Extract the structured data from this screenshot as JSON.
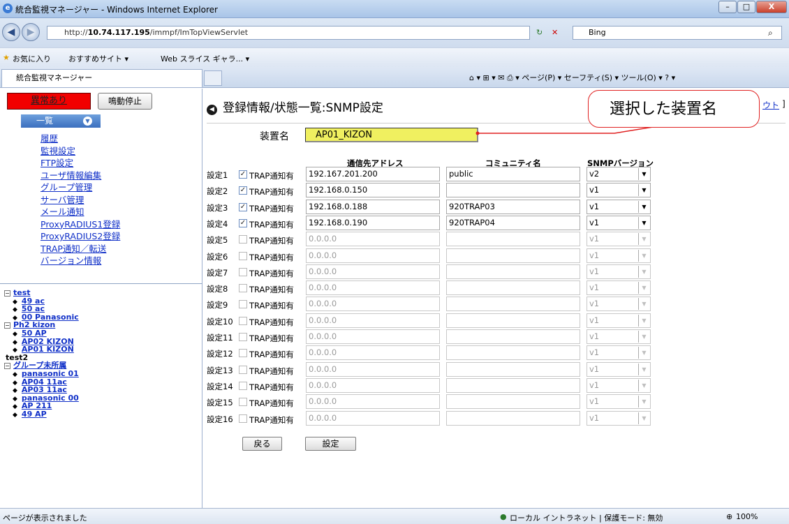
{
  "window": {
    "title": "統合監視マネージャー - Windows Internet Explorer",
    "min": "–",
    "max": "□",
    "close": "X"
  },
  "address": {
    "url_prefix": "http://",
    "url_host": "10.74.117.195",
    "url_path": "/immpf/ImTopViewServlet",
    "search_text": "Bing"
  },
  "favorites": {
    "fav": "お気に入り",
    "recommended": "おすすめサイト ▾",
    "webslice": "Web スライス ギャラ... ▾"
  },
  "tab": {
    "title": "統合監視マネージャー"
  },
  "commands": {
    "text": "⌂ ▾  ⊞ ▾  ✉  ⎙ ▾  ページ(P) ▾  セーフティ(S) ▾  ツール(O) ▾  ? ▾"
  },
  "sidebar": {
    "alarm": "異常あり",
    "stop": "鳴動停止",
    "list": "一覧",
    "menu": [
      "履歴",
      "監視設定",
      "FTP設定",
      "ユーザ情報編集",
      "グループ管理",
      "サーバ管理",
      "メール通知",
      "ProxyRADIUS1登録",
      "ProxyRADIUS2登録",
      "TRAP通知／転送",
      "バージョン情報"
    ],
    "tree": {
      "test": "test",
      "ac49": "49 ac",
      "ac50": "50 ac",
      "pana00a": "00 Panasonic",
      "ph2": "Ph2 kizon",
      "ap50": "50 AP",
      "ap02": "AP02 KIZON",
      "ap01": "AP01 KIZON",
      "test2": "test2",
      "group": "グループ未所属",
      "pana01": "panasonic 01",
      "ap04": "AP04 11ac",
      "ap03": "AP03 11ac",
      "pana00": "panasonic 00",
      "ap211": "AP 211",
      "ap49": "49 AP"
    }
  },
  "main": {
    "title": "登録情報/状態一覧:SNMP設定",
    "logout": "ウト",
    "logout_bracket": "]",
    "device_label": "装置名",
    "device_name": "AP01_KIZON",
    "callout": "選択した装置名",
    "headers": {
      "address": "通信先アドレス",
      "community": "コミュニティ名",
      "version": "SNMPバージョン"
    },
    "trap_label": "TRAP通知有",
    "rows": [
      {
        "label": "設定1",
        "checked": true,
        "address": "192.167.201.200",
        "community": "public",
        "version": "v2"
      },
      {
        "label": "設定2",
        "checked": true,
        "address": "192.168.0.150",
        "community": "",
        "version": "v1"
      },
      {
        "label": "設定3",
        "checked": true,
        "address": "192.168.0.188",
        "community": "920TRAP03",
        "version": "v1"
      },
      {
        "label": "設定4",
        "checked": true,
        "address": "192.168.0.190",
        "community": "920TRAP04",
        "version": "v1"
      },
      {
        "label": "設定5",
        "checked": false,
        "address": "0.0.0.0",
        "community": "",
        "version": "v1"
      },
      {
        "label": "設定6",
        "checked": false,
        "address": "0.0.0.0",
        "community": "",
        "version": "v1"
      },
      {
        "label": "設定7",
        "checked": false,
        "address": "0.0.0.0",
        "community": "",
        "version": "v1"
      },
      {
        "label": "設定8",
        "checked": false,
        "address": "0.0.0.0",
        "community": "",
        "version": "v1"
      },
      {
        "label": "設定9",
        "checked": false,
        "address": "0.0.0.0",
        "community": "",
        "version": "v1"
      },
      {
        "label": "設定10",
        "checked": false,
        "address": "0.0.0.0",
        "community": "",
        "version": "v1"
      },
      {
        "label": "設定11",
        "checked": false,
        "address": "0.0.0.0",
        "community": "",
        "version": "v1"
      },
      {
        "label": "設定12",
        "checked": false,
        "address": "0.0.0.0",
        "community": "",
        "version": "v1"
      },
      {
        "label": "設定13",
        "checked": false,
        "address": "0.0.0.0",
        "community": "",
        "version": "v1"
      },
      {
        "label": "設定14",
        "checked": false,
        "address": "0.0.0.0",
        "community": "",
        "version": "v1"
      },
      {
        "label": "設定15",
        "checked": false,
        "address": "0.0.0.0",
        "community": "",
        "version": "v1"
      },
      {
        "label": "設定16",
        "checked": false,
        "address": "0.0.0.0",
        "community": "",
        "version": "v1"
      }
    ],
    "back": "戻る",
    "set": "設定"
  },
  "statusbar": {
    "left": "ページが表示されました",
    "zone": "ローカル イントラネット | 保護モード: 無効",
    "zoom": "100%"
  },
  "colors": {
    "alarm": "#f20000",
    "device_field": "#f0f060",
    "callout_border": "#e02020",
    "link": "#1030c8"
  }
}
